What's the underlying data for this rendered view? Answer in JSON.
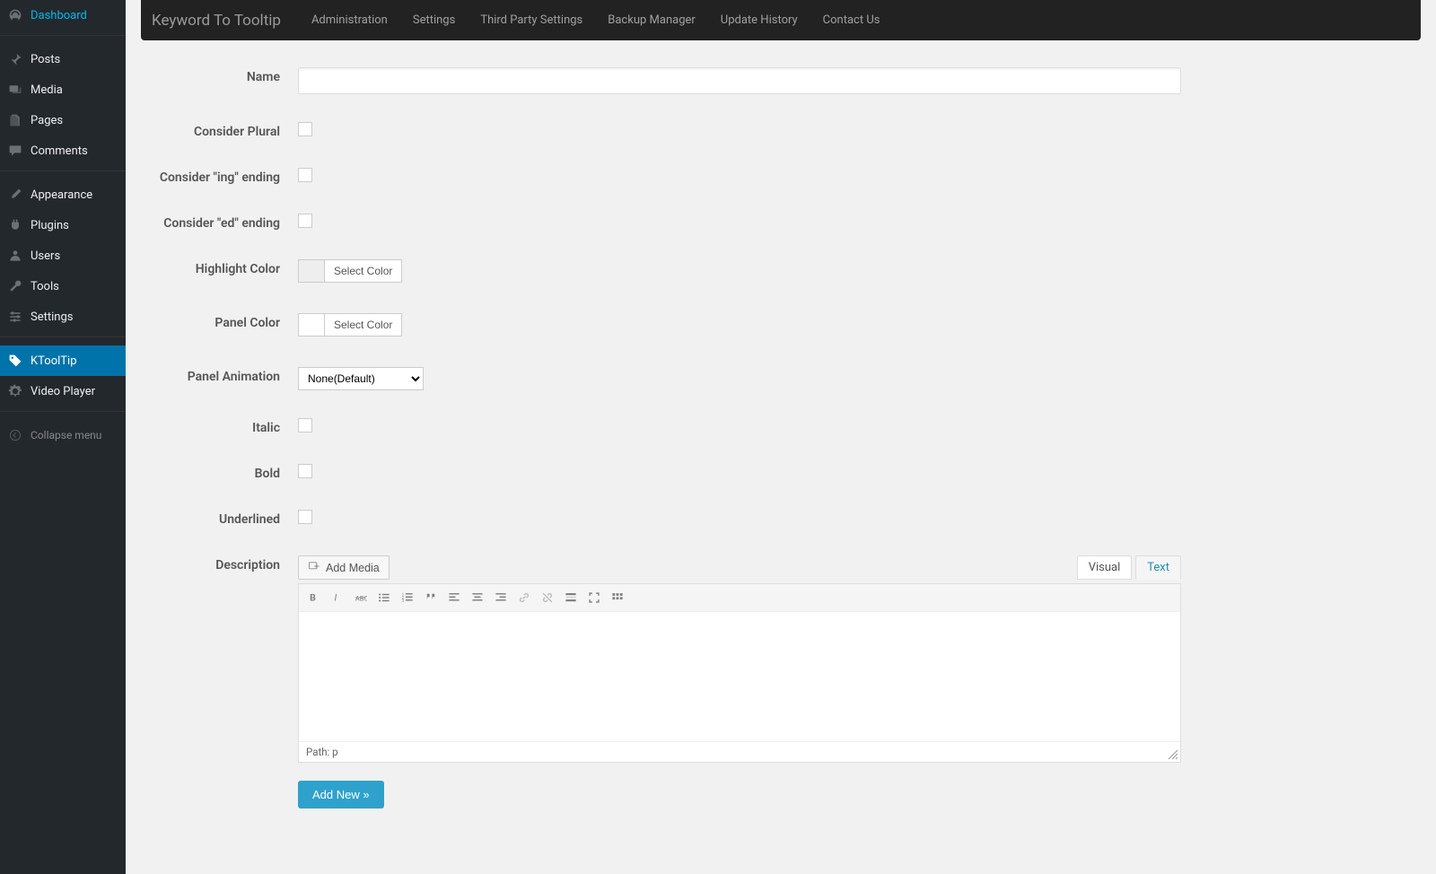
{
  "sidebar": {
    "items": [
      {
        "label": "Dashboard",
        "icon": "gauge"
      },
      {
        "label": "Posts",
        "icon": "pin"
      },
      {
        "label": "Media",
        "icon": "media"
      },
      {
        "label": "Pages",
        "icon": "pages"
      },
      {
        "label": "Comments",
        "icon": "comment"
      },
      {
        "label": "Appearance",
        "icon": "brush"
      },
      {
        "label": "Plugins",
        "icon": "plug"
      },
      {
        "label": "Users",
        "icon": "user"
      },
      {
        "label": "Tools",
        "icon": "wrench"
      },
      {
        "label": "Settings",
        "icon": "sliders"
      },
      {
        "label": "KToolTip",
        "icon": "tag"
      },
      {
        "label": "Video Player",
        "icon": "gear"
      }
    ],
    "collapse_label": "Collapse menu"
  },
  "topbar": {
    "brand": "Keyword To Tooltip",
    "links": [
      "Administration",
      "Settings",
      "Third Party Settings",
      "Backup Manager",
      "Update History",
      "Contact Us"
    ]
  },
  "form": {
    "labels": {
      "name": "Name",
      "plural": "Consider Plural",
      "ing": "Consider \"ing\" ending",
      "ed": "Consider \"ed\" ending",
      "highlight": "Highlight Color",
      "panel_color": "Panel Color",
      "panel_anim": "Panel Animation",
      "italic": "Italic",
      "bold": "Bold",
      "underlined": "Underlined",
      "description": "Description"
    },
    "name_value": "",
    "select_color_btn": "Select Color",
    "anim_value": "None(Default)",
    "add_media_label": "Add Media",
    "tabs": {
      "visual": "Visual",
      "text": "Text"
    },
    "path_label": "Path: p",
    "submit_label": "Add New »"
  },
  "colors": {
    "highlight_swatch": "#eeeeee",
    "panel_swatch": "#ffffff",
    "accent": "#2ea2cc"
  }
}
